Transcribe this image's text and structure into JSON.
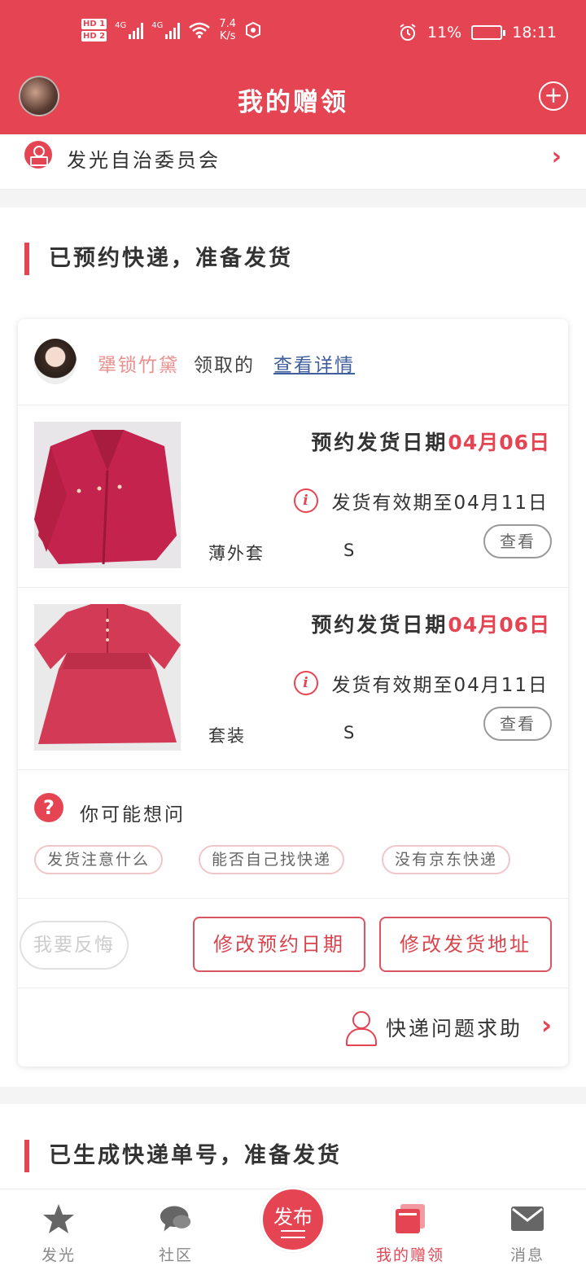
{
  "status_bar": {
    "hd1": "HD 1",
    "hd2": "HD 2",
    "net1": "4G",
    "net2": "4G",
    "speed_value": "7.4",
    "speed_unit": "K/s",
    "battery_percent": "11%",
    "time": "18:11"
  },
  "header": {
    "title": "我的赠领"
  },
  "group": {
    "name": "发光自治委员会"
  },
  "section1": {
    "title": "已预约快递，准备发货",
    "receiver": {
      "name": "犟锁竹黛",
      "action": "领取的",
      "detail_link": "查看详情"
    },
    "items": [
      {
        "date_label": "预约发货日期",
        "date_value": "04月06日",
        "validity": "发货有效期至04月11日",
        "name": "薄外套",
        "size": "S",
        "view_label": "查看"
      },
      {
        "date_label": "预约发货日期",
        "date_value": "04月06日",
        "validity": "发货有效期至04月11日",
        "name": "套装",
        "size": "S",
        "view_label": "查看"
      }
    ],
    "faq": {
      "title": "你可能想问",
      "chips": [
        "发货注意什么",
        "能否自己找快递",
        "没有京东快递"
      ]
    },
    "actions": {
      "regret": "我要反悔",
      "change_date": "修改预约日期",
      "change_address": "修改发货地址"
    },
    "help": "快递问题求助"
  },
  "section2": {
    "title": "已生成快递单号，准备发货"
  },
  "bottom_nav": {
    "items": [
      {
        "label": "发光",
        "icon": "star-icon"
      },
      {
        "label": "社区",
        "icon": "chat-icon"
      },
      {
        "label": "发布",
        "icon": "publish-icon"
      },
      {
        "label": "我的赠领",
        "icon": "gift-box-icon"
      },
      {
        "label": "消息",
        "icon": "mail-icon"
      }
    ],
    "active_index": 3
  },
  "colors": {
    "accent": "#e54553",
    "receiver_name": "#e9908f",
    "link": "#3f5f9e"
  }
}
